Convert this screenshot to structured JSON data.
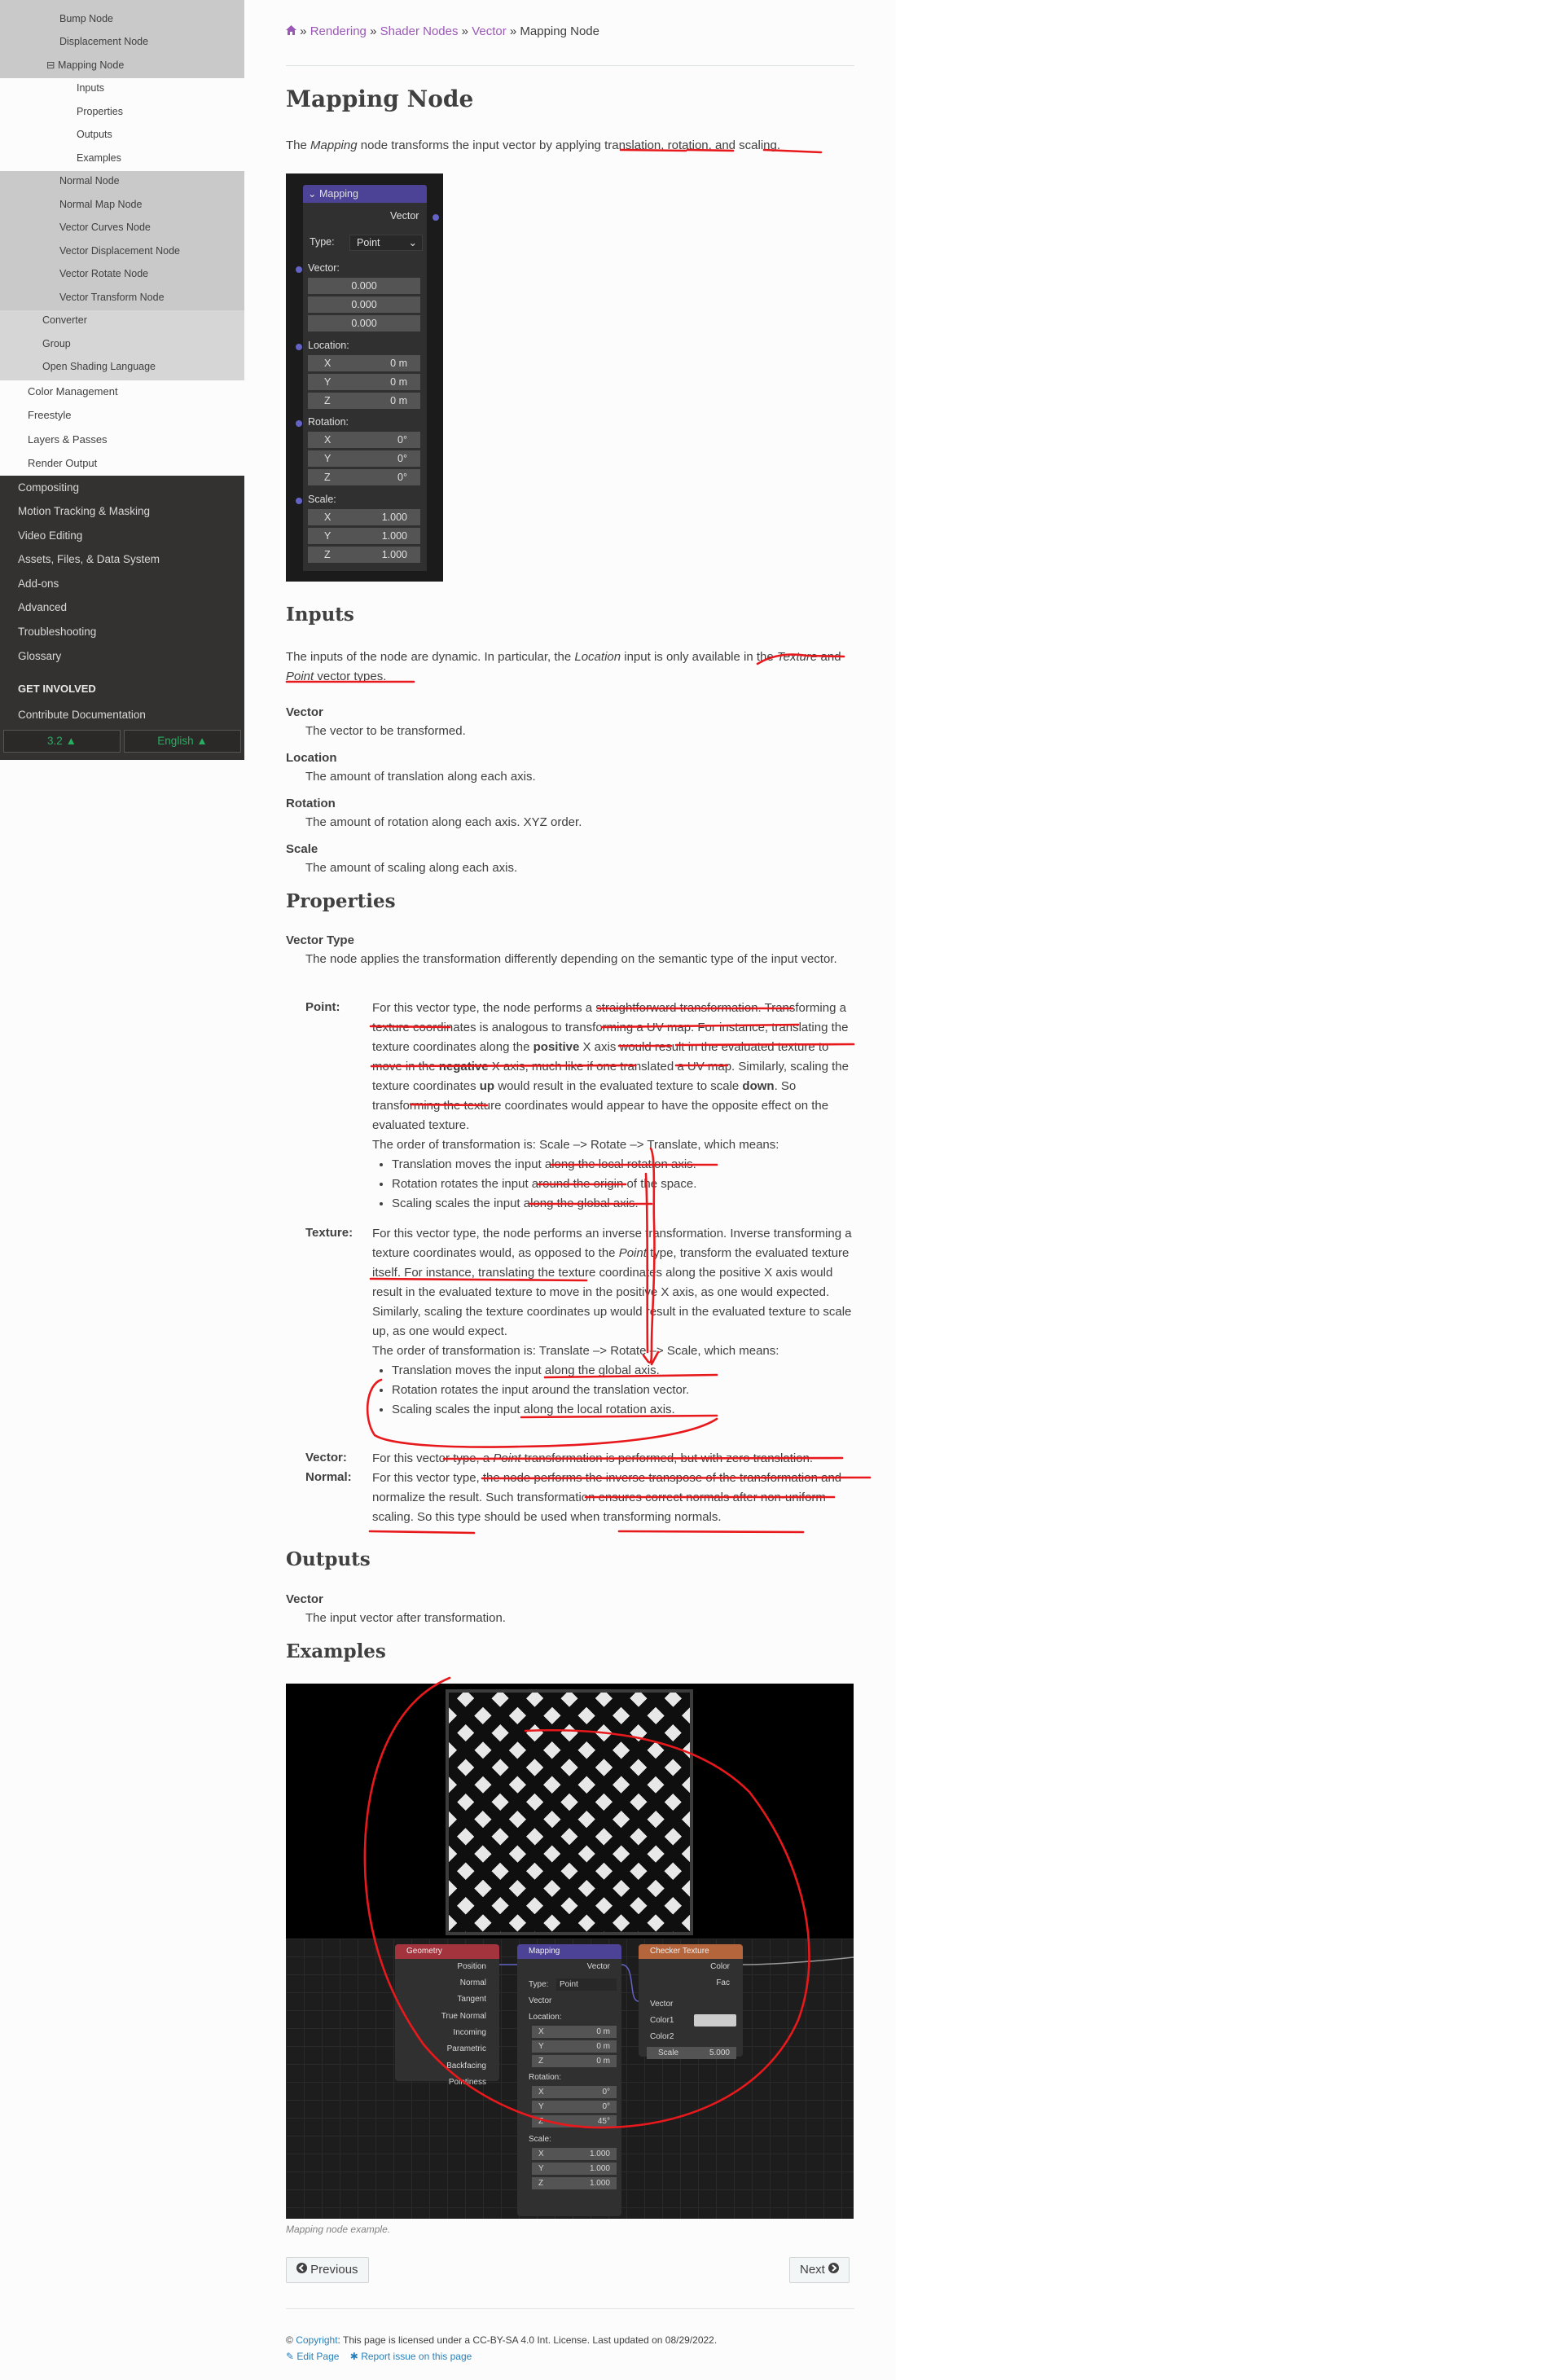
{
  "sidebar": {
    "light_items": [
      {
        "label": "Bump Node"
      },
      {
        "label": "Displacement Node"
      },
      {
        "label": "Mapping Node",
        "toggle": "⊟"
      },
      {
        "label": "Inputs"
      },
      {
        "label": "Properties"
      },
      {
        "label": "Outputs"
      },
      {
        "label": "Examples"
      },
      {
        "label": "Normal Node"
      },
      {
        "label": "Normal Map Node"
      },
      {
        "label": "Vector Curves Node"
      },
      {
        "label": "Vector Displacement Node"
      },
      {
        "label": "Vector Rotate Node"
      },
      {
        "label": "Vector Transform Node"
      },
      {
        "label": "Converter"
      },
      {
        "label": "Group"
      },
      {
        "label": "Open Shading Language"
      },
      {
        "label": "Color Management"
      },
      {
        "label": "Freestyle"
      },
      {
        "label": "Layers & Passes"
      },
      {
        "label": "Render Output"
      }
    ],
    "dark_items": [
      {
        "label": "Compositing"
      },
      {
        "label": "Motion Tracking & Masking"
      },
      {
        "label": "Video Editing"
      },
      {
        "label": "Assets, Files, & Data System"
      },
      {
        "label": "Add-ons"
      },
      {
        "label": "Advanced"
      },
      {
        "label": "Troubleshooting"
      },
      {
        "label": "Glossary"
      }
    ],
    "get_involved": "GET INVOLVED",
    "contribute": "Contribute Documentation",
    "version": "3.2 ▲",
    "language": "English ▲"
  },
  "breadcrumb": {
    "home_icon": "home-icon",
    "sep": "»",
    "items": [
      "Rendering",
      "Shader Nodes",
      "Vector"
    ],
    "current": "Mapping Node"
  },
  "page": {
    "title": "Mapping Node",
    "intro": {
      "a": "The ",
      "em": "Mapping",
      "b": " node transforms the input vector by applying translation, rotation, and scaling."
    }
  },
  "node_panel": {
    "header": "Mapping",
    "chevron": "⌄",
    "vector_out": "Vector",
    "type_label": "Type:",
    "type_value": "Point",
    "type_arrow": "⌄",
    "vector_label": "Vector:",
    "vector_values": [
      "0.000",
      "0.000",
      "0.000"
    ],
    "location_label": "Location:",
    "location": [
      {
        "axis": "X",
        "value": "0 m"
      },
      {
        "axis": "Y",
        "value": "0 m"
      },
      {
        "axis": "Z",
        "value": "0 m"
      }
    ],
    "rotation_label": "Rotation:",
    "rotation": [
      {
        "axis": "X",
        "value": "0°"
      },
      {
        "axis": "Y",
        "value": "0°"
      },
      {
        "axis": "Z",
        "value": "0°"
      }
    ],
    "scale_label": "Scale:",
    "scale": [
      {
        "axis": "X",
        "value": "1.000"
      },
      {
        "axis": "Y",
        "value": "1.000"
      },
      {
        "axis": "Z",
        "value": "1.000"
      }
    ]
  },
  "inputs": {
    "heading": "Inputs",
    "para": {
      "a": "The inputs of the node are dynamic. In particular, the ",
      "em1": "Location",
      "b": " input is only available in the ",
      "em2": "Texture",
      "c": " and ",
      "em3": "Point",
      "d": " vector types."
    },
    "items": [
      {
        "term": "Vector",
        "desc": "The vector to be transformed."
      },
      {
        "term": "Location",
        "desc": "The amount of translation along each axis."
      },
      {
        "term": "Rotation",
        "desc": "The amount of rotation along each axis. XYZ order."
      },
      {
        "term": "Scale",
        "desc": "The amount of scaling along each axis."
      }
    ]
  },
  "properties": {
    "heading": "Properties",
    "vector_type_term": "Vector Type",
    "vector_type_desc": "The node applies the transformation differently depending on the semantic type of the input vector.",
    "point": {
      "label": "Point:",
      "p1": "For this vector type, the node performs a straightforward transformation. Transforming a texture coordinates is analogous to transforming a UV map. For instance, translating the texture coordinates along the ",
      "b1": "positive",
      "p2": " X axis would result in the evaluated texture to move in the ",
      "b2": "negative",
      "p3": " X axis, much like if one translated a UV map. Similarly, scaling the texture coordinates ",
      "b3": "up",
      "p4": " would result in the evaluated texture to scale ",
      "b4": "down",
      "p5": ". So transforming the texture coordinates would appear to have the opposite effect on the evaluated texture.",
      "order": "The order of transformation is: Scale –> Rotate –> Translate, which means:",
      "bullets": [
        "Translation moves the input along the local rotation axis.",
        "Rotation rotates the input around the origin of the space.",
        "Scaling scales the input along the global axis."
      ]
    },
    "texture": {
      "label": "Texture:",
      "p1": "For this vector type, the node performs an inverse transformation. Inverse transforming a texture coordinates would, as opposed to the ",
      "em1": "Point",
      "p2": " type, transform the evaluated texture itself. For instance, translating the texture coordinates along the positive X axis would result in the evaluated texture to move in the positive X axis, as one would expected. Similarly, scaling the texture coordinates up would result in the evaluated texture to scale up, as one would expect.",
      "order": "The order of transformation is: Translate –> Rotate –> Scale, which means:",
      "bullets": [
        "Translation moves the input along the global axis.",
        "Rotation rotates the input around the translation vector.",
        "Scaling scales the input along the local rotation axis."
      ]
    },
    "vector": {
      "label": "Vector:",
      "a": "For this vector type, a ",
      "em": "Point",
      "b": " transformation is performed, but with zero translation."
    },
    "normal": {
      "label": "Normal:",
      "text": "For this vector type, the node performs the inverse transpose of the transformation and normalize the result. Such transformation ensures correct normals after non-uniform scaling. So this type should be used when transforming normals."
    }
  },
  "outputs": {
    "heading": "Outputs",
    "term": "Vector",
    "desc": "The input vector after transformation."
  },
  "examples": {
    "heading": "Examples",
    "caption": "Mapping node example.",
    "geometry": {
      "title": "Geometry",
      "outputs": [
        "Position",
        "Normal",
        "Tangent",
        "True Normal",
        "Incoming",
        "Parametric",
        "Backfacing",
        "Pointiness"
      ]
    },
    "mapping": {
      "title": "Mapping",
      "vector_out": "Vector",
      "type_label": "Type:",
      "type_value": "Point",
      "vector_in": "Vector",
      "location_label": "Location:",
      "location": [
        {
          "axis": "X",
          "value": "0 m"
        },
        {
          "axis": "Y",
          "value": "0 m"
        },
        {
          "axis": "Z",
          "value": "0 m"
        }
      ],
      "rotation_label": "Rotation:",
      "rotation": [
        {
          "axis": "X",
          "value": "0°"
        },
        {
          "axis": "Y",
          "value": "0°"
        },
        {
          "axis": "Z",
          "value": "45°"
        }
      ],
      "scale_label": "Scale:",
      "scale": [
        {
          "axis": "X",
          "value": "1.000"
        },
        {
          "axis": "Y",
          "value": "1.000"
        },
        {
          "axis": "Z",
          "value": "1.000"
        }
      ]
    },
    "checker": {
      "title": "Checker Texture",
      "out_color": "Color",
      "out_fac": "Fac",
      "in_vector": "Vector",
      "in_color1": "Color1",
      "in_color2": "Color2",
      "scale_label": "Scale",
      "scale_value": "5.000"
    }
  },
  "nav": {
    "previous": "Previous",
    "previous_icon": "arrow-circle-left-icon",
    "next": "Next",
    "next_icon": "arrow-circle-right-icon"
  },
  "footer": {
    "copyright_symbol": "©",
    "copyright_link": "Copyright",
    "license": ": This page is licensed under a CC-BY-SA 4.0 Int. License. Last updated on 08/29/2022.",
    "edit_page": "Edit Page",
    "report_issue": "Report issue on this page"
  },
  "colors": {
    "link": "#9b59b6",
    "footer_link": "#2980b9",
    "annotation": "#e8191c",
    "sidebar_dark": "#343131",
    "sidebar_band": "#c9c9c9",
    "node_header_mapping": "#4c4396",
    "node_header_geometry": "#a3343d",
    "node_header_checker": "#b5653b",
    "version_text": "#27ae60"
  }
}
